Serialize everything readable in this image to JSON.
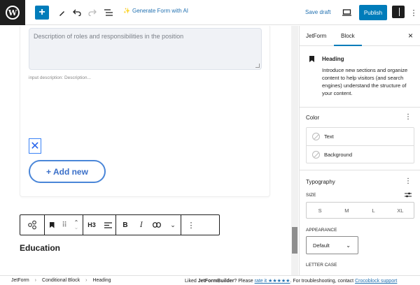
{
  "topbar": {
    "wp_logo": "W",
    "add_icon": "+",
    "generate_ai_label": "Generate Form with AI",
    "save_draft_label": "Save draft",
    "publish_label": "Publish"
  },
  "editor": {
    "textarea_placeholder": "Description of roles and responsibilities in the position",
    "input_description": "input description:  Description...",
    "remove_icon": "✕",
    "add_new_label": "+ Add new",
    "toolbar": {
      "heading_level": "H3"
    },
    "heading_text": "Education"
  },
  "sidebar": {
    "tabs": [
      "JetForm",
      "Block"
    ],
    "active_tab": "Block",
    "block_title": "Heading",
    "block_description": "Introduce new sections and organize content to help visitors (and search engines) understand the structure of your content.",
    "color": {
      "title": "Color",
      "rows": [
        "Text",
        "Background"
      ]
    },
    "typography": {
      "title": "Typography",
      "size_label": "SIZE",
      "size_options": [
        "S",
        "M",
        "L",
        "XL"
      ],
      "appearance_label": "APPEARANCE",
      "appearance_value": "Default",
      "letter_case_label": "LETTER CASE"
    }
  },
  "footer": {
    "breadcrumbs": [
      "JetForm",
      "Conditional Block",
      "Heading"
    ],
    "note_prefix": "Liked ",
    "note_brand": "JetFormBuilder",
    "note_mid": "? Please ",
    "note_rate": "rate it ★★★★★",
    "note_after": ". For troubleshooting, contact ",
    "note_support": "Crocoblock support"
  },
  "colors": {
    "accent": "#007cba",
    "link": "#2271b1",
    "add_new": "#3a6fc8"
  }
}
